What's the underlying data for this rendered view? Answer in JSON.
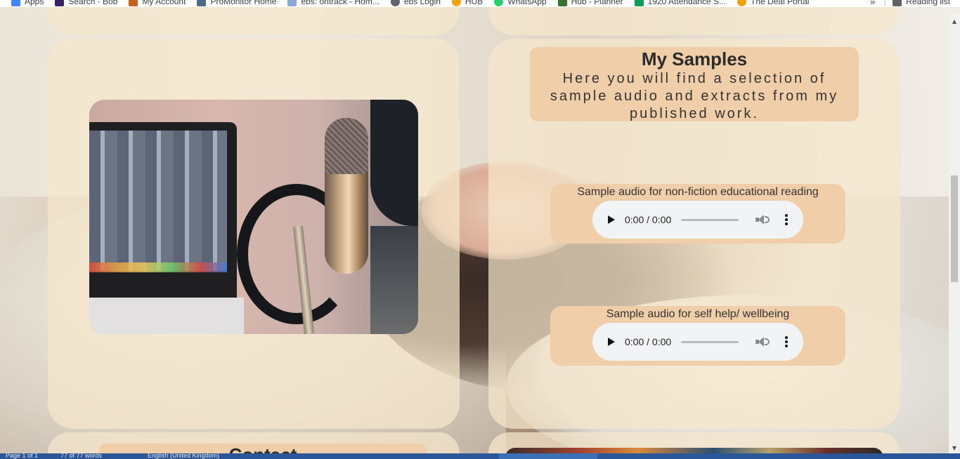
{
  "bookmarks": [
    {
      "label": "Apps",
      "icon": "apps-grid-icon",
      "color": "#4285f4"
    },
    {
      "label": "Search · Bob",
      "icon": "search-bob-icon",
      "color": "#3b1f5f"
    },
    {
      "label": "My Account",
      "icon": "my-account-icon",
      "color": "#c8621a"
    },
    {
      "label": "ProMonitor Home",
      "icon": "promonitor-icon",
      "color": "#4a6b8a"
    },
    {
      "label": "ebs: ontrack - Hom...",
      "icon": "document-icon",
      "color": "#8aa9d6"
    },
    {
      "label": "ebs Login",
      "icon": "globe-icon",
      "color": "#5f6368"
    },
    {
      "label": "HUB",
      "icon": "hub-icon",
      "color": "#f2a20c"
    },
    {
      "label": "WhatsApp",
      "icon": "whatsapp-icon",
      "color": "#25d366"
    },
    {
      "label": "Hub - Planner",
      "icon": "planner-icon",
      "color": "#31752f"
    },
    {
      "label": "1920 Attendance S...",
      "icon": "sheets-icon",
      "color": "#0f9d58"
    },
    {
      "label": "The Deal Portal",
      "icon": "deal-portal-icon",
      "color": "#f2a20c"
    }
  ],
  "bookmarks_more": "»",
  "reading_list": "Reading list",
  "samples": {
    "title": "My Samples",
    "description": "Here you will find a selection of sample audio and extracts from my published work."
  },
  "audio": [
    {
      "caption": "Sample audio for non-fiction educational reading",
      "time": "0:00 / 0:00"
    },
    {
      "caption": "Sample audio for self help/ wellbeing",
      "time": "0:00 / 0:00"
    }
  ],
  "contact": {
    "title": "Contact"
  },
  "status_bar": {
    "page": "Page 1 of 1",
    "words": "77 of 77 words",
    "language": "English (United Kingdom)"
  },
  "colors": {
    "card": "#f6e8cc",
    "accent_panel": "#f0cea9",
    "player": "#f1f3f4"
  }
}
